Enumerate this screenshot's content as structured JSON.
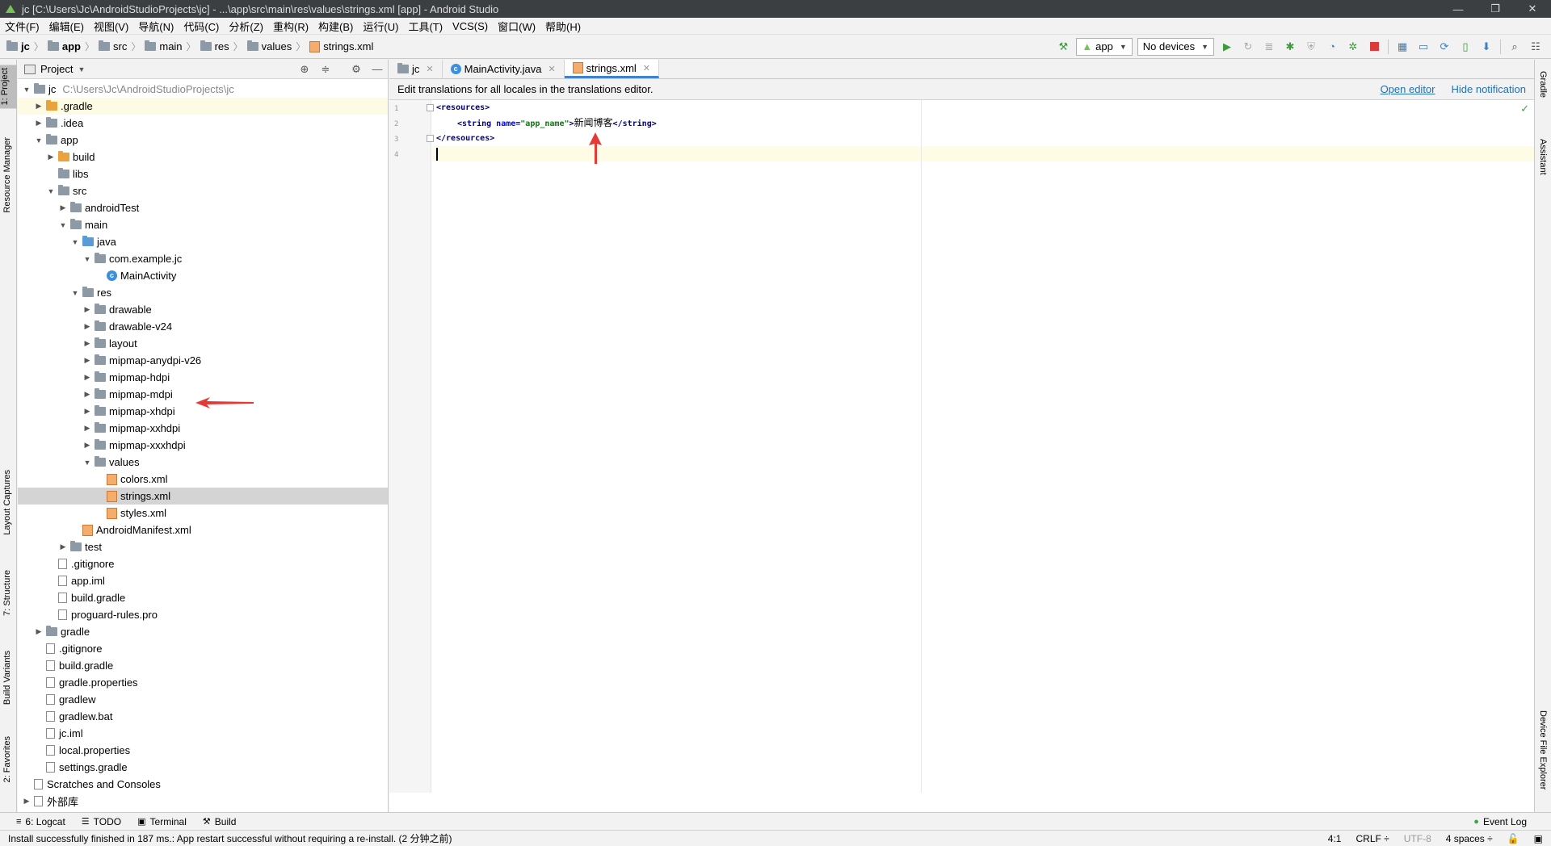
{
  "window": {
    "title": "jc [C:\\Users\\Jc\\AndroidStudioProjects\\jc] - ...\\app\\src\\main\\res\\values\\strings.xml [app] - Android Studio",
    "minimize": "—",
    "restore": "❐",
    "close": "✕"
  },
  "menu": [
    "文件(F)",
    "编辑(E)",
    "视图(V)",
    "导航(N)",
    "代码(C)",
    "分析(Z)",
    "重构(R)",
    "构建(B)",
    "运行(U)",
    "工具(T)",
    "VCS(S)",
    "窗口(W)",
    "帮助(H)"
  ],
  "breadcrumb": [
    "jc",
    "app",
    "src",
    "main",
    "res",
    "values",
    "strings.xml"
  ],
  "toolbar": {
    "run_config": "app",
    "device": "No devices"
  },
  "left_tabs": {
    "project": "1: Project",
    "resource_manager": "Resource Manager",
    "layout_captures": "Layout Captures",
    "structure": "7: Structure",
    "build_variants": "Build Variants",
    "favorites": "2: Favorites"
  },
  "right_tabs": {
    "gradle": "Gradle",
    "assistant": "Assistant",
    "device_file_explorer": "Device File Explorer"
  },
  "project_panel": {
    "title": "Project",
    "root_label": "jc",
    "root_path": "C:\\Users\\Jc\\AndroidStudioProjects\\jc",
    "items": [
      {
        "label": ".gradle",
        "depth": 1,
        "arrow": "▶",
        "icon": "folder-orange",
        "hl": true
      },
      {
        "label": ".idea",
        "depth": 1,
        "arrow": "▶",
        "icon": "folder"
      },
      {
        "label": "app",
        "depth": 1,
        "arrow": "▼",
        "icon": "folder"
      },
      {
        "label": "build",
        "depth": 2,
        "arrow": "▶",
        "icon": "folder-orange"
      },
      {
        "label": "libs",
        "depth": 2,
        "arrow": "",
        "icon": "folder"
      },
      {
        "label": "src",
        "depth": 2,
        "arrow": "▼",
        "icon": "folder"
      },
      {
        "label": "androidTest",
        "depth": 3,
        "arrow": "▶",
        "icon": "folder"
      },
      {
        "label": "main",
        "depth": 3,
        "arrow": "▼",
        "icon": "folder"
      },
      {
        "label": "java",
        "depth": 4,
        "arrow": "▼",
        "icon": "folder-blue"
      },
      {
        "label": "com.example.jc",
        "depth": 5,
        "arrow": "▼",
        "icon": "folder"
      },
      {
        "label": "MainActivity",
        "depth": 6,
        "arrow": "",
        "icon": "class"
      },
      {
        "label": "res",
        "depth": 4,
        "arrow": "▼",
        "icon": "folder"
      },
      {
        "label": "drawable",
        "depth": 5,
        "arrow": "▶",
        "icon": "folder"
      },
      {
        "label": "drawable-v24",
        "depth": 5,
        "arrow": "▶",
        "icon": "folder"
      },
      {
        "label": "layout",
        "depth": 5,
        "arrow": "▶",
        "icon": "folder"
      },
      {
        "label": "mipmap-anydpi-v26",
        "depth": 5,
        "arrow": "▶",
        "icon": "folder"
      },
      {
        "label": "mipmap-hdpi",
        "depth": 5,
        "arrow": "▶",
        "icon": "folder"
      },
      {
        "label": "mipmap-mdpi",
        "depth": 5,
        "arrow": "▶",
        "icon": "folder"
      },
      {
        "label": "mipmap-xhdpi",
        "depth": 5,
        "arrow": "▶",
        "icon": "folder"
      },
      {
        "label": "mipmap-xxhdpi",
        "depth": 5,
        "arrow": "▶",
        "icon": "folder"
      },
      {
        "label": "mipmap-xxxhdpi",
        "depth": 5,
        "arrow": "▶",
        "icon": "folder"
      },
      {
        "label": "values",
        "depth": 5,
        "arrow": "▼",
        "icon": "folder"
      },
      {
        "label": "colors.xml",
        "depth": 6,
        "arrow": "",
        "icon": "xml"
      },
      {
        "label": "strings.xml",
        "depth": 6,
        "arrow": "",
        "icon": "xml",
        "sel": true
      },
      {
        "label": "styles.xml",
        "depth": 6,
        "arrow": "",
        "icon": "xml"
      },
      {
        "label": "AndroidManifest.xml",
        "depth": 4,
        "arrow": "",
        "icon": "xml"
      },
      {
        "label": "test",
        "depth": 3,
        "arrow": "▶",
        "icon": "folder"
      },
      {
        "label": ".gitignore",
        "depth": 2,
        "arrow": "",
        "icon": "file"
      },
      {
        "label": "app.iml",
        "depth": 2,
        "arrow": "",
        "icon": "file"
      },
      {
        "label": "build.gradle",
        "depth": 2,
        "arrow": "",
        "icon": "file"
      },
      {
        "label": "proguard-rules.pro",
        "depth": 2,
        "arrow": "",
        "icon": "file"
      },
      {
        "label": "gradle",
        "depth": 1,
        "arrow": "▶",
        "icon": "folder"
      },
      {
        "label": ".gitignore",
        "depth": 1,
        "arrow": "",
        "icon": "file"
      },
      {
        "label": "build.gradle",
        "depth": 1,
        "arrow": "",
        "icon": "file"
      },
      {
        "label": "gradle.properties",
        "depth": 1,
        "arrow": "",
        "icon": "file"
      },
      {
        "label": "gradlew",
        "depth": 1,
        "arrow": "",
        "icon": "file"
      },
      {
        "label": "gradlew.bat",
        "depth": 1,
        "arrow": "",
        "icon": "file"
      },
      {
        "label": "jc.iml",
        "depth": 1,
        "arrow": "",
        "icon": "file"
      },
      {
        "label": "local.properties",
        "depth": 1,
        "arrow": "",
        "icon": "file"
      },
      {
        "label": "settings.gradle",
        "depth": 1,
        "arrow": "",
        "icon": "file"
      },
      {
        "label": "Scratches and Consoles",
        "depth": 0,
        "arrow": "",
        "icon": "file"
      },
      {
        "label": "外部库",
        "depth": 0,
        "arrow": "▶",
        "icon": "file"
      }
    ]
  },
  "editor": {
    "tabs": [
      {
        "label": "jc",
        "close": "✕"
      },
      {
        "label": "MainActivity.java",
        "close": "✕"
      },
      {
        "label": "strings.xml",
        "close": "✕",
        "active": true
      }
    ],
    "notification": "Edit translations for all locales in the translations editor.",
    "open_editor": "Open editor",
    "hide_notification": "Hide notification",
    "line_numbers": [
      "1",
      "2",
      "3",
      "4"
    ],
    "code": {
      "l1": "<resources>",
      "l2_open": "<string ",
      "l2_attr": "name=",
      "l2_val": "\"app_name\"",
      "l2_gt": ">",
      "l2_text": "新闻博客",
      "l2_close": "</string>",
      "l3": "</resources>"
    }
  },
  "bottom_tools": [
    {
      "icon": "≡",
      "label": "6: Logcat"
    },
    {
      "icon": "☰",
      "label": "TODO"
    },
    {
      "icon": "▣",
      "label": "Terminal"
    },
    {
      "icon": "⚒",
      "label": "Build"
    }
  ],
  "event_log": "Event Log",
  "status": {
    "message": "Install successfully finished in 187 ms.: App restart successful without requiring a re-install. (2 分钟之前)",
    "position": "4:1",
    "line_sep": "CRLF ÷",
    "encoding": "UTF-8",
    "indent": "4 spaces ÷"
  },
  "colors": {
    "accent": "#4083c9",
    "xml_tag": "#000080",
    "xml_attr": "#0000ff",
    "xml_value": "#008000",
    "annotation_arrow": "#e53935"
  }
}
